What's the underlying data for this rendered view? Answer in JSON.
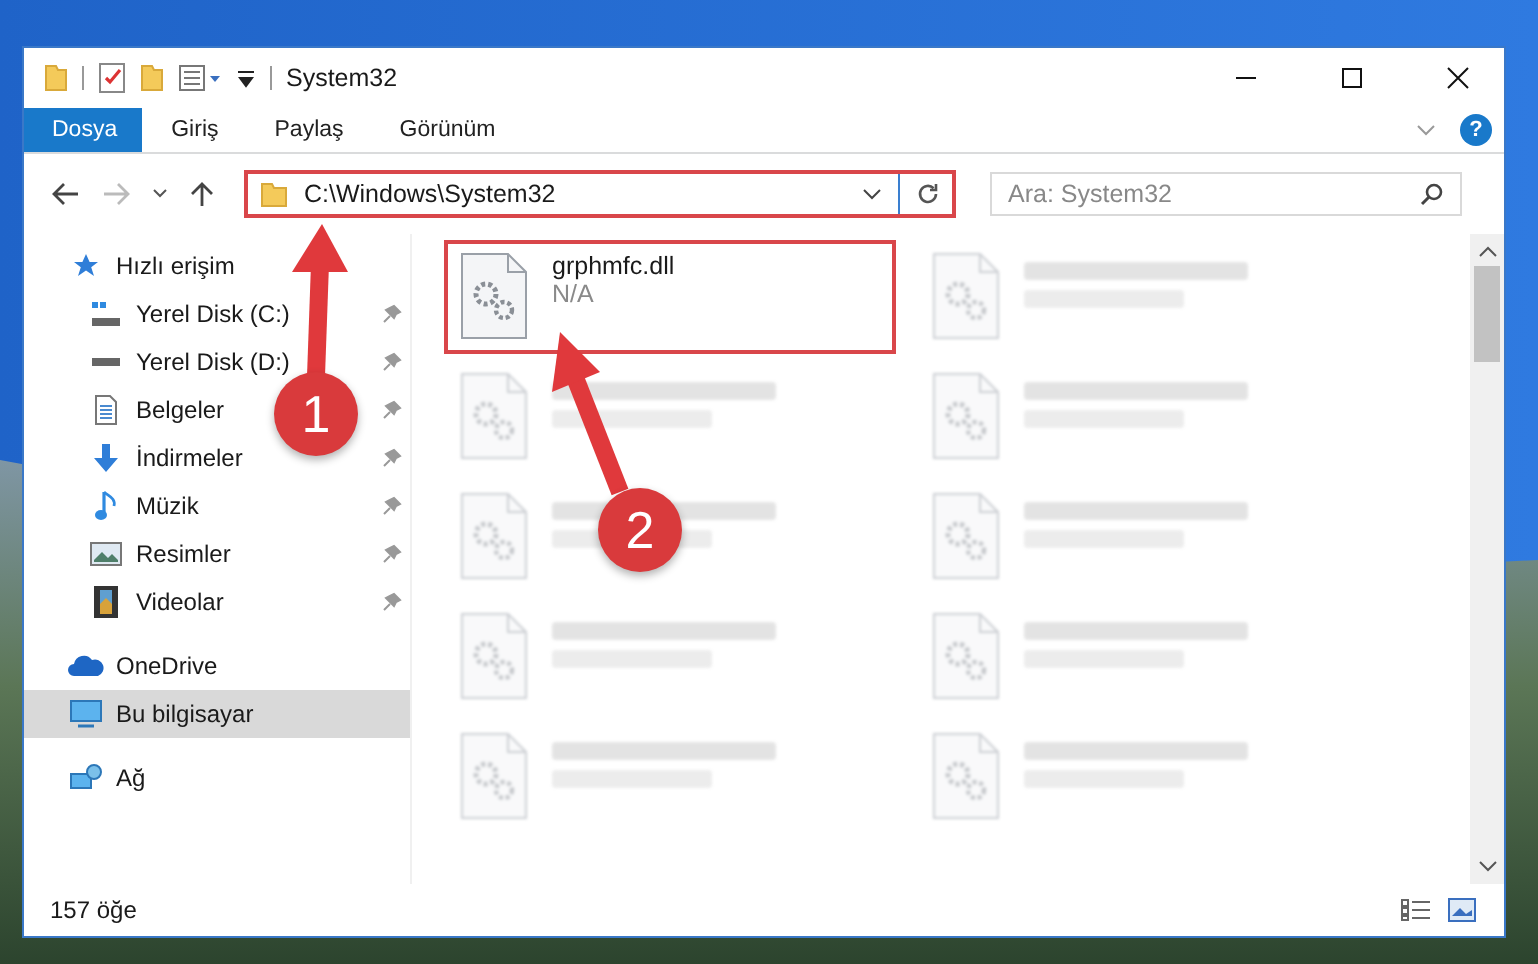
{
  "window": {
    "title": "System32"
  },
  "ribbon": {
    "tabs": [
      {
        "label": "Dosya",
        "selected": true
      },
      {
        "label": "Giriş",
        "selected": false
      },
      {
        "label": "Paylaş",
        "selected": false
      },
      {
        "label": "Görünüm",
        "selected": false
      }
    ],
    "help": "?"
  },
  "address_bar": {
    "path": "C:\\Windows\\System32",
    "highlighted": true
  },
  "search": {
    "placeholder": "Ara: System32"
  },
  "sidebar": {
    "items": [
      {
        "label": "Hızlı erişim",
        "kind": "star",
        "selected": false,
        "children": [
          {
            "label": "Yerel Disk (C:)",
            "kind": "system-drive",
            "pinned": true,
            "selected": false
          },
          {
            "label": "Yerel Disk (D:)",
            "kind": "drive",
            "pinned": true,
            "selected": false
          },
          {
            "label": "Belgeler",
            "kind": "documents",
            "pinned": true,
            "selected": false
          },
          {
            "label": "İndirmeler",
            "kind": "downloads",
            "pinned": true,
            "selected": false
          },
          {
            "label": "Müzik",
            "kind": "music",
            "pinned": true,
            "selected": false
          },
          {
            "label": "Resimler",
            "kind": "pictures",
            "pinned": true,
            "selected": false
          },
          {
            "label": "Videolar",
            "kind": "videos",
            "pinned": true,
            "selected": false
          }
        ]
      },
      {
        "label": "OneDrive",
        "kind": "cloud",
        "selected": false
      },
      {
        "label": "Bu bilgisayar",
        "kind": "computer",
        "selected": true
      },
      {
        "label": "Ağ",
        "kind": "network",
        "selected": false
      }
    ]
  },
  "files": [
    {
      "name": "grphmfc.dll",
      "description": "N/A",
      "blurred": false,
      "highlighted": true
    },
    {
      "blurred": true,
      "highlighted": false
    },
    {
      "blurred": true,
      "highlighted": false
    },
    {
      "blurred": true,
      "highlighted": false
    },
    {
      "blurred": true,
      "highlighted": false
    },
    {
      "blurred": true,
      "highlighted": false
    },
    {
      "blurred": true,
      "highlighted": false
    },
    {
      "blurred": true,
      "highlighted": false
    },
    {
      "blurred": true,
      "highlighted": false
    },
    {
      "blurred": true,
      "highlighted": false
    }
  ],
  "status_bar": {
    "item_count": "157 öğe"
  },
  "annotations": [
    {
      "label": "1"
    },
    {
      "label": "2"
    }
  ]
}
